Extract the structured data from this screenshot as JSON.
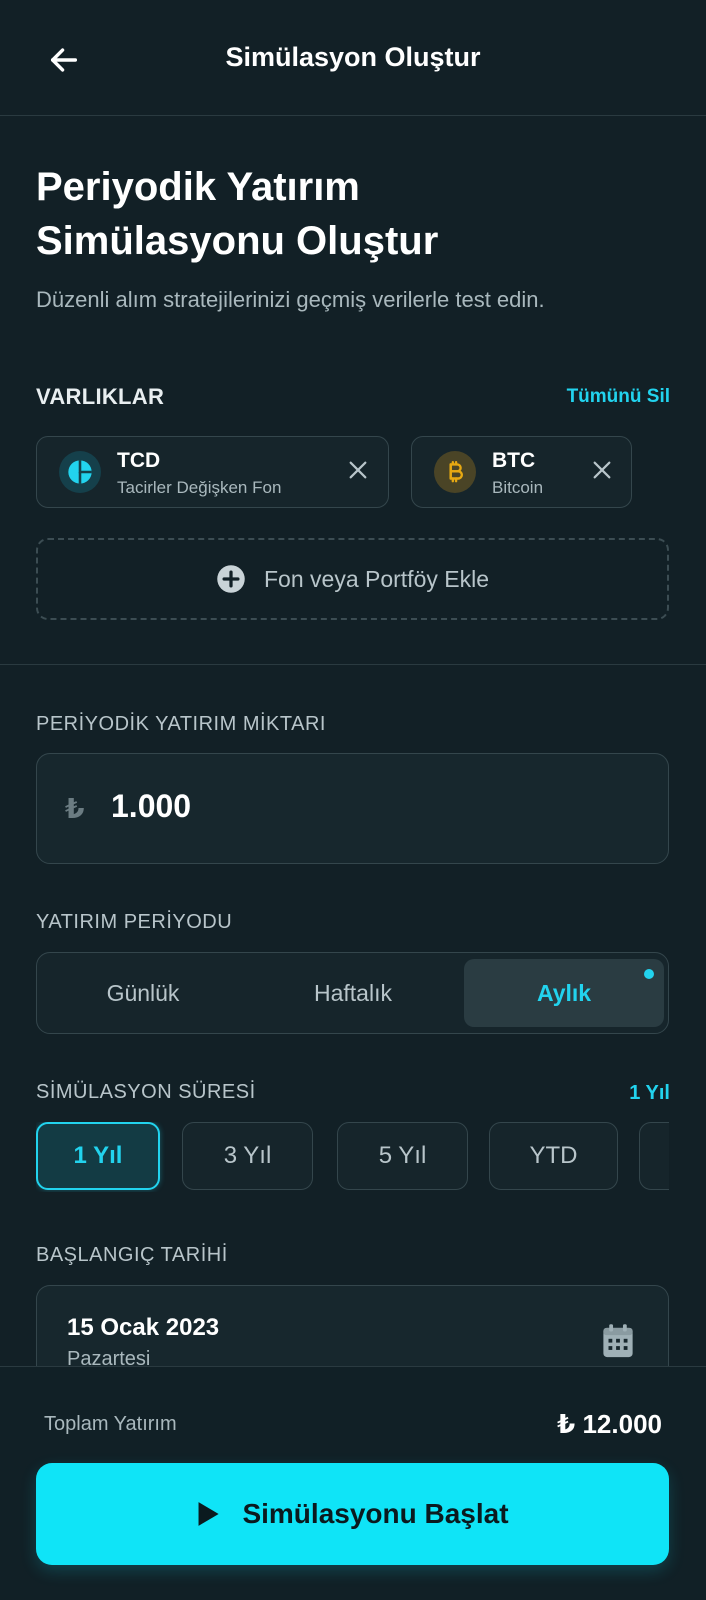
{
  "header": {
    "title": "Simülasyon Oluştur",
    "back_icon": "arrow-left-icon"
  },
  "hero": {
    "title_line1": "Periyodik Yatırım",
    "title_line2": "Simülasyonu Oluştur",
    "subtitle": "Düzenli alım stratejilerinizi geçmiş verilerle test edin."
  },
  "assets": {
    "label": "VARLIKLAR",
    "clear_all": "Tümünü Sil",
    "items": [
      {
        "code": "TCD",
        "name": "Tacirler Değişken Fon",
        "icon": "pie-chart-icon",
        "color": "#22d3ee"
      },
      {
        "code": "BTC",
        "name": "Bitcoin",
        "icon": "bitcoin-icon",
        "color": "#e6a812"
      }
    ],
    "add_label": "Fon veya Portföy Ekle"
  },
  "amount": {
    "label": "PERİYODİK YATIRIM MİKTARI",
    "currency": "₺",
    "value": "1.000"
  },
  "period": {
    "label": "YATIRIM PERİYODU",
    "options": [
      "Günlük",
      "Haftalık",
      "Aylık"
    ],
    "selected": "Aylık"
  },
  "duration": {
    "label": "SİMÜLASYON SÜRESİ",
    "selected_display": "1 Yıl",
    "options": [
      "1 Yıl",
      "3 Yıl",
      "5 Yıl",
      "YTD"
    ]
  },
  "start_date": {
    "label": "BAŞLANGIÇ TARİHİ",
    "date": "15 Ocak 2023",
    "day": "Pazartesi"
  },
  "footer": {
    "total_label": "Toplam Yatırım",
    "total_value": "₺ 12.000",
    "start_label": "Simülasyonu Başlat"
  },
  "colors": {
    "accent": "#22d3ee",
    "background": "#122026",
    "button": "#0fe4f7"
  }
}
